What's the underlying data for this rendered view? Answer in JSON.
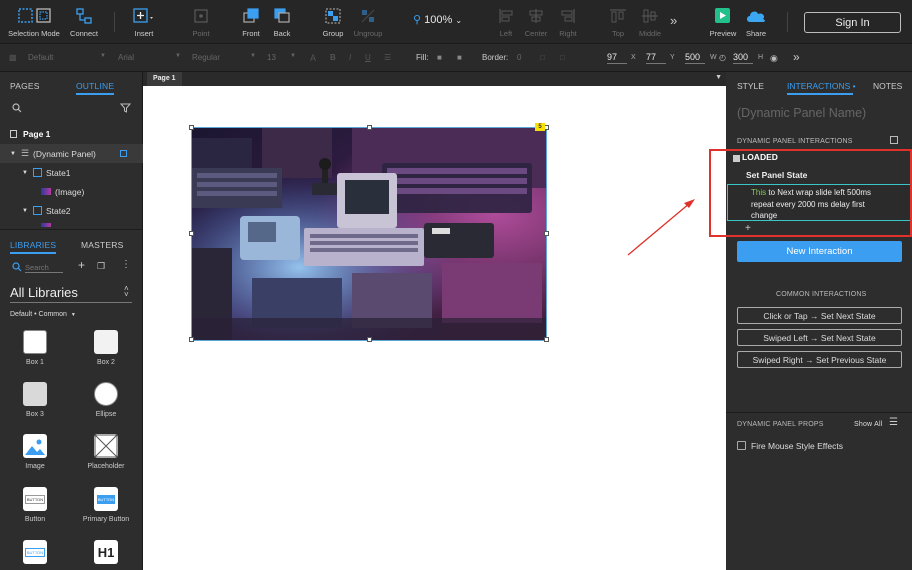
{
  "toolbar": {
    "selection_mode": "Selection Mode",
    "connect": "Connect",
    "insert": "Insert",
    "point": "Point",
    "front": "Front",
    "back": "Back",
    "group": "Group",
    "ungroup": "Ungroup",
    "zoom": "100%",
    "left": "Left",
    "center": "Center",
    "right": "Right",
    "top": "Top",
    "middle": "Middle",
    "preview": "Preview",
    "share": "Share",
    "sign_in": "Sign In"
  },
  "formatbar": {
    "style": "Default",
    "font": "Arial",
    "weight": "Regular",
    "size": "13",
    "fill_label": "Fill:",
    "border_label": "Border:",
    "border_value": "0",
    "x": "97",
    "y": "77",
    "w": "500",
    "h": "300",
    "x_label": "X",
    "y_label": "Y",
    "w_label": "W",
    "h_label": "H"
  },
  "left": {
    "pages_tab": "PAGES",
    "outline_tab": "OUTLINE",
    "outline": [
      {
        "label": "Page 1"
      },
      {
        "label": "(Dynamic Panel)"
      },
      {
        "label": "State1"
      },
      {
        "label": "(Image)"
      },
      {
        "label": "State2"
      }
    ],
    "libraries_tab": "LIBRARIES",
    "masters_tab": "MASTERS",
    "search_placeholder": "Search",
    "library_select": "All Libraries",
    "library_sub": "Default • Common",
    "widgets": [
      {
        "label": "Box 1"
      },
      {
        "label": "Box 2"
      },
      {
        "label": "Box 3"
      },
      {
        "label": "Ellipse"
      },
      {
        "label": "Image"
      },
      {
        "label": "Placeholder"
      },
      {
        "label": "Button"
      },
      {
        "label": "Primary Button"
      }
    ],
    "button_text": "BUTTON",
    "heading_text": "H1"
  },
  "canvas": {
    "page_tab": "Page 1",
    "badge": "5"
  },
  "right": {
    "style_tab": "STYLE",
    "interactions_tab": "INTERACTIONS •",
    "notes_tab": "NOTES",
    "panel_name": "(Dynamic Panel Name)",
    "dp_interactions": "DYNAMIC PANEL INTERACTIONS",
    "event": "LOADED",
    "action": "Set Panel State",
    "detail_this": "This",
    "detail_line1": " to Next wrap slide left 500ms",
    "detail_line2": "repeat every 2000 ms delay first",
    "detail_line3": "change",
    "add": "+",
    "new_interaction": "New Interaction",
    "common_title": "COMMON INTERACTIONS",
    "common": [
      {
        "label": "Click or Tap → Set Next State"
      },
      {
        "label": "Swiped Left → Set Next State"
      },
      {
        "label": "Swiped Right → Set Previous State"
      }
    ],
    "props_title": "DYNAMIC PANEL PROPS",
    "show_all": "Show All",
    "fire_mouse": "Fire Mouse Style Effects"
  },
  "colors": {
    "accent": "#3b9ef0",
    "annotation_red": "#e0312b",
    "selection_cyan": "#37c7c7"
  }
}
